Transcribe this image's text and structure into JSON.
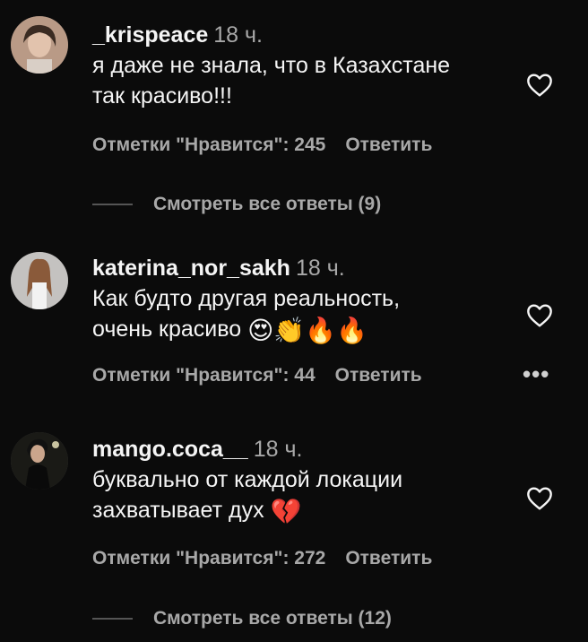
{
  "comments": [
    {
      "username": "_krispeace",
      "time": "18 ч.",
      "text_lines": [
        "я даже не знала, что в Казахстане",
        "так красиво!!!"
      ],
      "likes": "Отметки \"Нравится\": 245",
      "reply": "Ответить",
      "view_replies": "Смотреть все ответы (9)"
    },
    {
      "username": "katerina_nor_sakh",
      "time": "18 ч.",
      "text_lines": [
        "Как будто другая реальность,",
        "очень красиво"
      ],
      "emojis": "😍👏🔥🔥",
      "likes": "Отметки \"Нравится\": 44",
      "reply": "Ответить",
      "more": "•••"
    },
    {
      "username": "mango.coca__",
      "time": "18 ч.",
      "text_lines": [
        "буквально от каждой локации",
        "захватывает дух"
      ],
      "emojis": "💔",
      "likes": "Отметки \"Нравится\": 272",
      "reply": "Ответить",
      "view_replies": "Смотреть все ответы (12)"
    }
  ],
  "icons": {
    "like": "heart-outline-icon",
    "more": "more-dots-icon"
  },
  "colors": {
    "background": "#0b0b0b",
    "text": "#f5f5f5",
    "secondary": "#a8a8a8"
  }
}
